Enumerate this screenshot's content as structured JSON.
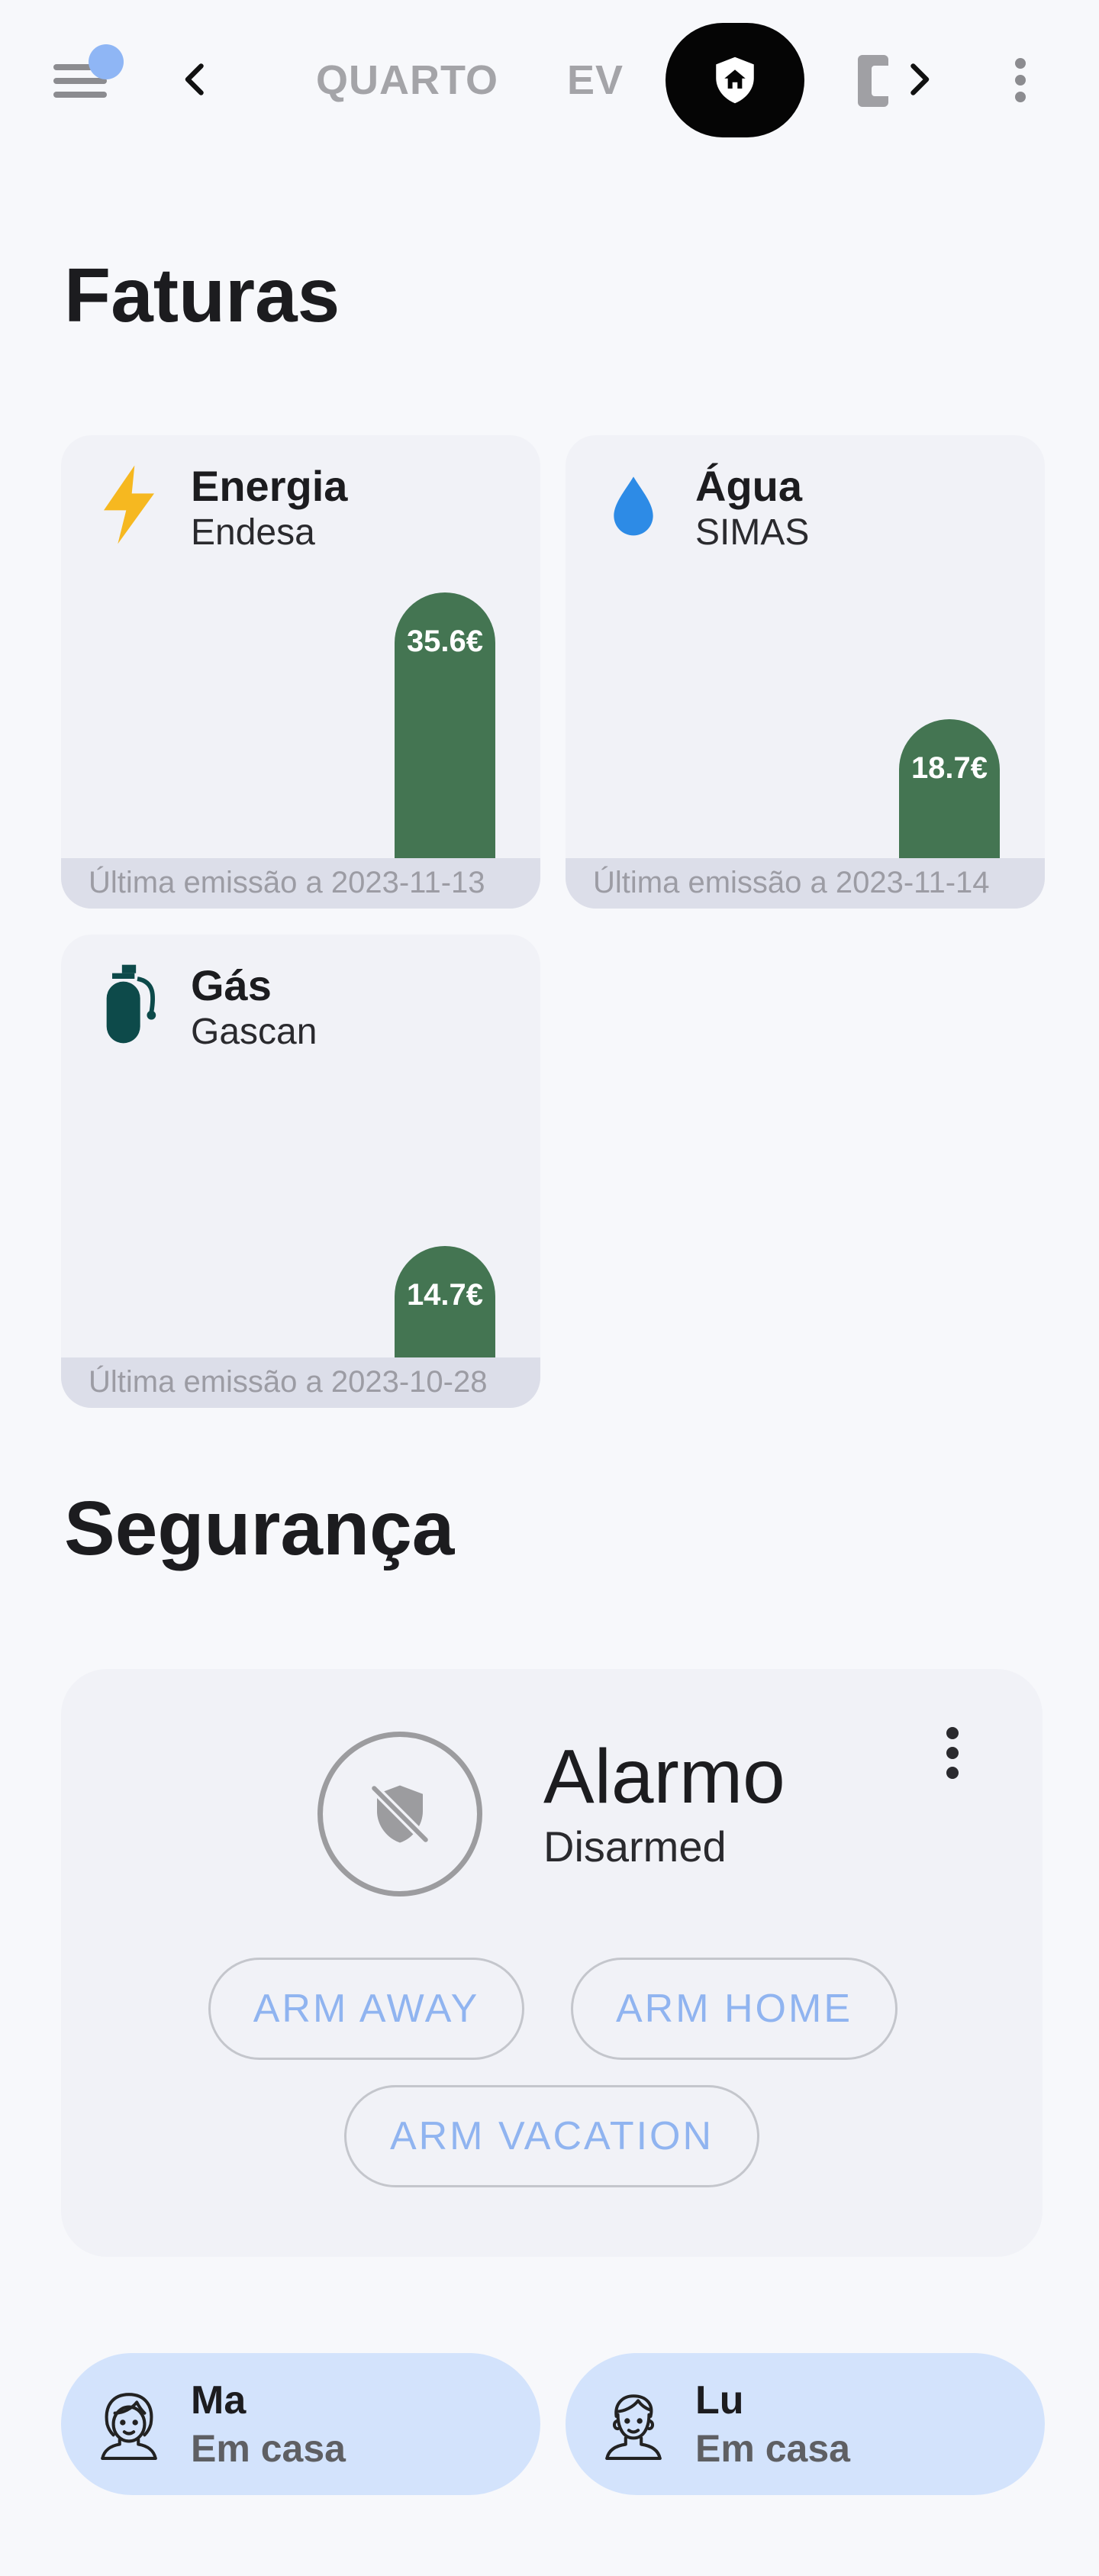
{
  "topbar": {
    "tabs": [
      {
        "label": "QUARTO"
      },
      {
        "label": "EV"
      }
    ],
    "active_tab_icon": "home-shield-icon"
  },
  "faturas": {
    "title": "Faturas",
    "bills": [
      {
        "name": "Energia",
        "provider": "Endesa",
        "value": "35.6€",
        "amount": 35.6,
        "footer": "Última emissão a 2023-11-13",
        "icon": "lightning-icon",
        "icon_color": "#f6b820"
      },
      {
        "name": "Água",
        "provider": "SIMAS",
        "value": "18.7€",
        "amount": 18.7,
        "footer": "Última emissão a 2023-11-14",
        "icon": "water-drop-icon",
        "icon_color": "#2d8be6"
      },
      {
        "name": "Gás",
        "provider": "Gascan",
        "value": "14.7€",
        "amount": 14.7,
        "footer": "Última emissão a 2023-10-28",
        "icon": "gas-cylinder-icon",
        "icon_color": "#0d4a4a"
      }
    ],
    "bar_color": "#447552"
  },
  "seguranca": {
    "title": "Segurança",
    "alarm": {
      "name": "Alarmo",
      "state": "Disarmed",
      "buttons": {
        "arm_away": "ARM AWAY",
        "arm_home": "ARM HOME",
        "arm_vacation": "ARM VACATION"
      }
    }
  },
  "people": [
    {
      "name": "Ma",
      "status": "Em casa",
      "icon": "woman-avatar-icon"
    },
    {
      "name": "Lu",
      "status": "Em casa",
      "icon": "man-avatar-icon"
    }
  ]
}
